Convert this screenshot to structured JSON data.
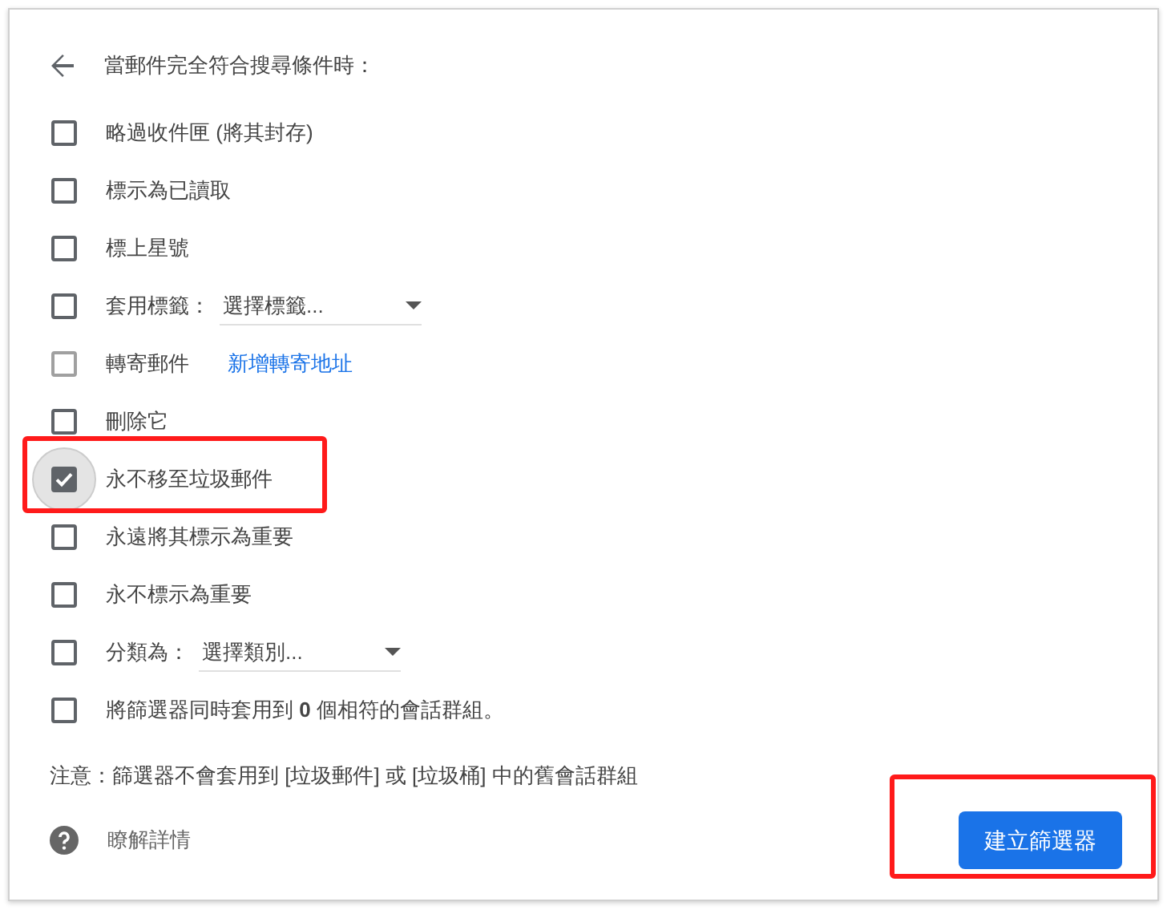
{
  "header": {
    "title": "當郵件完全符合搜尋條件時："
  },
  "options": [
    {
      "kind": "plain",
      "label": "略過收件匣 (將其封存)",
      "checked": false,
      "disabled": false,
      "highlighted": false
    },
    {
      "kind": "plain",
      "label": "標示為已讀取",
      "checked": false,
      "disabled": false,
      "highlighted": false
    },
    {
      "kind": "plain",
      "label": "標上星號",
      "checked": false,
      "disabled": false,
      "highlighted": false
    },
    {
      "kind": "dropdown",
      "label": "套用標籤：",
      "placeholder": "選擇標籤...",
      "checked": false,
      "disabled": false,
      "highlighted": false
    },
    {
      "kind": "link",
      "label": "轉寄郵件",
      "link": "新增轉寄地址",
      "checked": false,
      "disabled": true,
      "highlighted": false
    },
    {
      "kind": "plain",
      "label": "刪除它",
      "checked": false,
      "disabled": false,
      "highlighted": false
    },
    {
      "kind": "plain",
      "label": "永不移至垃圾郵件",
      "checked": true,
      "disabled": false,
      "highlighted": true
    },
    {
      "kind": "plain",
      "label": "永遠將其標示為重要",
      "checked": false,
      "disabled": false,
      "highlighted": false
    },
    {
      "kind": "plain",
      "label": "永不標示為重要",
      "checked": false,
      "disabled": false,
      "highlighted": false
    },
    {
      "kind": "dropdown",
      "label": "分類為：",
      "placeholder": "選擇類別...",
      "checked": false,
      "disabled": false,
      "highlighted": false
    },
    {
      "kind": "plain",
      "label": "將篩選器同時套用到 **0** 個相符的會話群組。",
      "checked": false,
      "disabled": false,
      "highlighted": false
    }
  ],
  "note": "注意：篩選器不會套用到 [垃圾郵件] 或 [垃圾桶] 中的舊會話群組",
  "learn_more": "瞭解詳情",
  "create_button": {
    "label": "建立篩選器",
    "highlighted": true
  }
}
